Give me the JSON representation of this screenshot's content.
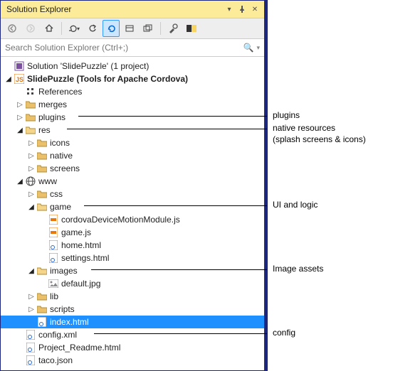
{
  "titlebar": {
    "title": "Solution Explorer"
  },
  "search": {
    "placeholder": "Search Solution Explorer (Ctrl+;)"
  },
  "tree": {
    "solution": "Solution 'SlidePuzzle' (1 project)",
    "project": "SlidePuzzle (Tools for Apache Cordova)",
    "references": "References",
    "merges": "merges",
    "plugins": "plugins",
    "res": "res",
    "res_icons": "icons",
    "res_native": "native",
    "res_screens": "screens",
    "www": "www",
    "www_css": "css",
    "www_game": "game",
    "game_cdm": "cordovaDeviceMotionModule.js",
    "game_game": "game.js",
    "game_home": "home.html",
    "game_settings": "settings.html",
    "www_images": "images",
    "images_default": "default.jpg",
    "www_lib": "lib",
    "www_scripts": "scripts",
    "www_index": "index.html",
    "config_xml": "config.xml",
    "project_readme": "Project_Readme.html",
    "taco_json": "taco.json"
  },
  "annotations": {
    "plugins": "plugins",
    "native": "native resources",
    "native2": "(splash screens & icons)",
    "ui_logic": "UI and logic",
    "image_assets": "Image assets",
    "config": "config"
  }
}
